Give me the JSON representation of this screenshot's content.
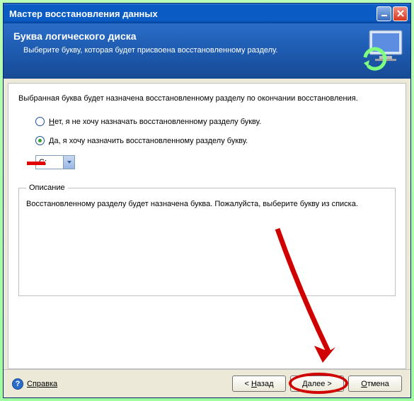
{
  "window": {
    "title": "Мастер восстановления данных"
  },
  "banner": {
    "heading": "Буква логического диска",
    "subtitle": "Выберите букву, которая будет присвоена восстановленному разделу."
  },
  "content": {
    "intro": "Выбранная буква будет назначена восстановленному разделу по окончании восстановления.",
    "option_no": "Нет, я не хочу назначать восстановленному разделу букву.",
    "option_yes": "Да, я хочу назначить восстановленному разделу букву.",
    "drive_value": "C:",
    "description_legend": "Описание",
    "description_text": "Восстановленному разделу будет назначена буква. Пожалуйста, выберите букву из списка."
  },
  "buttons": {
    "help": "Справка",
    "back": "< Назад",
    "next": "Далее >",
    "cancel": "Отмена"
  }
}
